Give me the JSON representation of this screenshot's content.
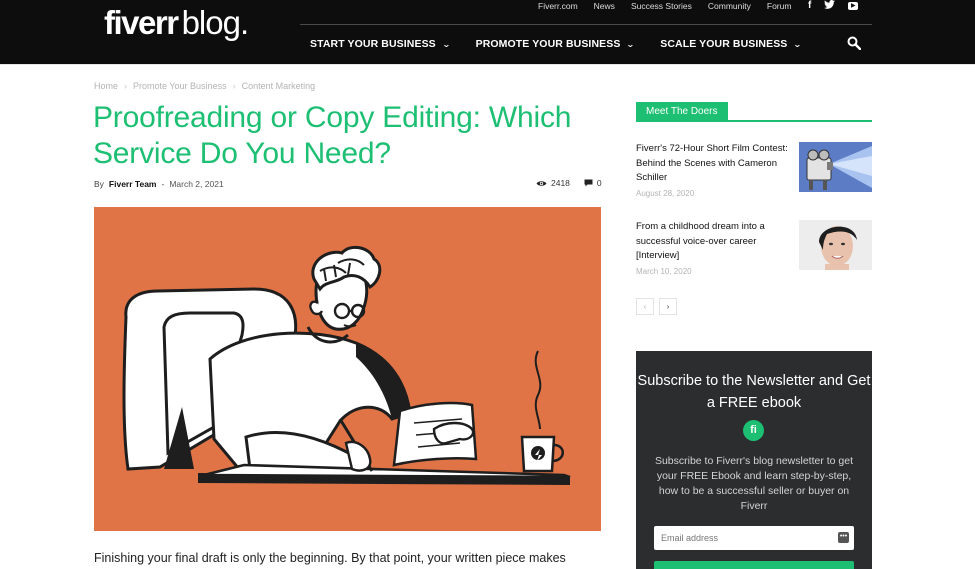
{
  "header": {
    "logo_brand": "fiverr",
    "logo_suffix": "blog.",
    "top_links": [
      "Fiverr.com",
      "News",
      "Success Stories",
      "Community",
      "Forum"
    ],
    "social_icons": [
      "facebook-icon",
      "twitter-icon",
      "youtube-icon"
    ],
    "main_nav": [
      {
        "label": "START YOUR BUSINESS"
      },
      {
        "label": "PROMOTE YOUR BUSINESS"
      },
      {
        "label": "SCALE YOUR BUSINESS"
      }
    ],
    "chevron": "⌄",
    "icons": {
      "search": "search-icon"
    }
  },
  "breadcrumb": [
    "Home",
    "Promote Your Business",
    "Content Marketing"
  ],
  "breadcrumb_sep": "›",
  "article": {
    "title": "Proofreading or Copy Editing: Which Service Do You Need?",
    "by_label": "By",
    "author": "Fiverr Team",
    "dash": "-",
    "date": "March 2, 2021",
    "views": "2418",
    "comments": "0",
    "intro": "Finishing your final draft is only the beginning. By that point, your written piece makes"
  },
  "sidebar": {
    "heading": "Meet The Doers",
    "posts": [
      {
        "title": "Fiverr's 72-Hour Short Film Contest: Behind the Scenes with Cameron Schiller",
        "date": "August 28, 2020"
      },
      {
        "title": "From a childhood dream into a successful voice-over career [Interview]",
        "date": "March 10, 2020"
      }
    ],
    "pager": {
      "prev": "‹",
      "next": "›"
    }
  },
  "newsletter": {
    "title": "Subscribe to the Newsletter and Get a FREE ebook",
    "icon_text": "fi",
    "text": "Subscribe to Fiverr's blog newsletter to get your FREE Ebook and learn step-by-step, how to be a successful seller or buyer on Fiverr",
    "email_placeholder": "Email address"
  },
  "colors": {
    "accent": "#1dbf73",
    "header_bg": "#0d0d0d",
    "hero_bg": "#e07447",
    "newsletter_bg": "#2b2d2f"
  }
}
